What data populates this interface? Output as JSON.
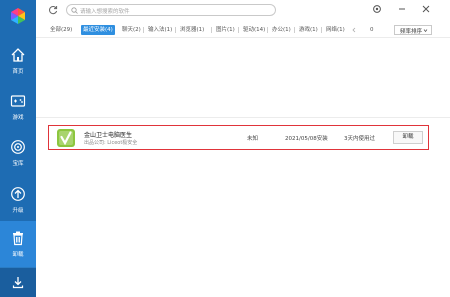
{
  "sidebar": {
    "items": [
      {
        "label": "首页",
        "icon": "home-icon"
      },
      {
        "label": "游戏",
        "icon": "gamepad-icon"
      },
      {
        "label": "宝库",
        "icon": "treasure-icon"
      },
      {
        "label": "升级",
        "icon": "upgrade-icon"
      },
      {
        "label": "卸载",
        "icon": "trash-icon"
      }
    ],
    "active_index": 4,
    "bottom_icon": "download-icon",
    "colors": {
      "background": "#1e6cb3",
      "active": "#2c86d8"
    }
  },
  "search": {
    "placeholder": "请输入想搜索的软件"
  },
  "window_controls": [
    "settings-icon",
    "minimize-icon",
    "close-icon"
  ],
  "tabs": [
    {
      "label": "全部(29)",
      "active": false
    },
    {
      "label": "最近安装(4)",
      "active": true
    },
    {
      "label": "聊天(2)",
      "active": false
    },
    {
      "label": "输入法(1)",
      "active": false
    },
    {
      "label": "浏览器(1)",
      "active": false
    },
    {
      "label": "图片(1)",
      "active": false
    },
    {
      "label": "驱动(14)",
      "active": false
    },
    {
      "label": "办公(1)",
      "active": false
    },
    {
      "label": "游戏(1)",
      "active": false
    },
    {
      "label": "网络(1)",
      "active": false
    }
  ],
  "overflow_count": "0",
  "sort": {
    "label": "频率排序"
  },
  "app_row": {
    "name": "金山卫士电脑医生",
    "publisher": "出品公司: Liceot极安全",
    "size": "未知",
    "install_date": "2021/05/08安装",
    "last_used": "3天内使用过",
    "uninstall_label": "卸载",
    "icon": "kingsoft-doctor-icon"
  }
}
